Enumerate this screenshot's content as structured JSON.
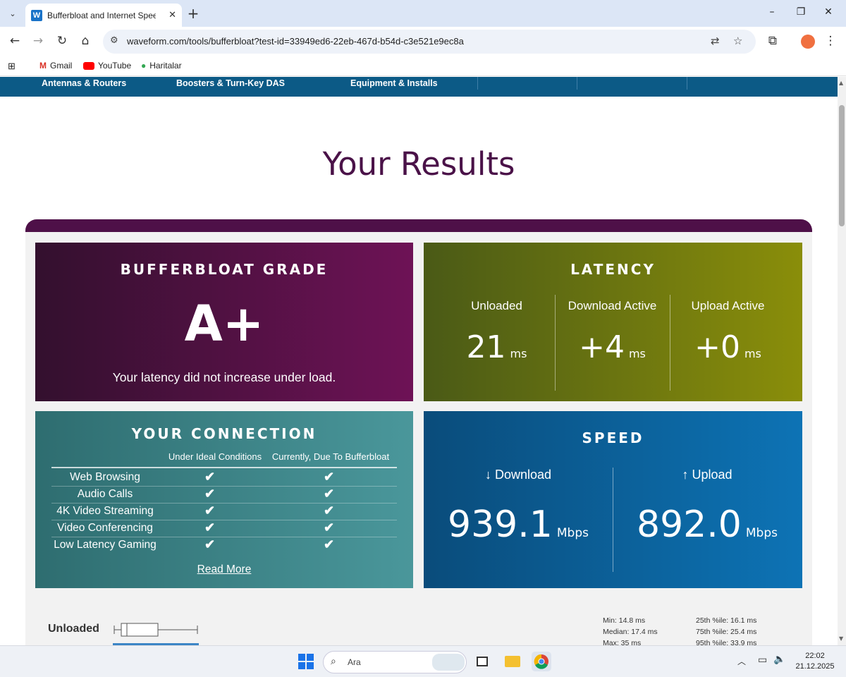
{
  "browser": {
    "tab_title": "Bufferbloat and Internet Speed",
    "tab_favicon": "W",
    "url": "waveform.com/tools/bufferbloat?test-id=33949ed6-22eb-467d-b54d-c3e521e9ec8a",
    "bookmarks": [
      "Gmail",
      "YouTube",
      "Haritalar"
    ]
  },
  "site_nav": {
    "items": [
      "Antennas & Routers",
      "Boosters & Turn-Key DAS",
      "Equipment & Installs"
    ]
  },
  "page": {
    "title": "Your Results"
  },
  "grade_card": {
    "heading": "BUFFERBLOAT GRADE",
    "grade": "A+",
    "message": "Your latency did not increase under load."
  },
  "latency_card": {
    "heading": "LATENCY",
    "columns": [
      {
        "label": "Unloaded",
        "value": "21",
        "unit": "ms"
      },
      {
        "label": "Download Active",
        "value": "+4",
        "unit": "ms"
      },
      {
        "label": "Upload Active",
        "value": "+0",
        "unit": "ms"
      }
    ]
  },
  "connection_card": {
    "heading": "YOUR CONNECTION",
    "col_ideal": "Under Ideal Conditions",
    "col_current": "Currently, Due To Bufferbloat",
    "rows": [
      {
        "name": "Web Browsing",
        "ideal": "✔",
        "current": "✔"
      },
      {
        "name": "Audio Calls",
        "ideal": "✔",
        "current": "✔"
      },
      {
        "name": "4K Video Streaming",
        "ideal": "✔",
        "current": "✔"
      },
      {
        "name": "Video Conferencing",
        "ideal": "✔",
        "current": "✔"
      },
      {
        "name": "Low Latency Gaming",
        "ideal": "✔",
        "current": "✔"
      }
    ],
    "read_more": "Read More"
  },
  "speed_card": {
    "heading": "SPEED",
    "download_label": "↓ Download",
    "download_value": "939.1",
    "download_unit": "Mbps",
    "upload_label": "↑ Upload",
    "upload_value": "892.0",
    "upload_unit": "Mbps"
  },
  "unloaded_stats": {
    "label": "Unloaded",
    "min": "Min: 14.8 ms",
    "median": "Median: 17.4 ms",
    "max": "Max: 35 ms",
    "p25": "25th %ile: 16.1 ms",
    "p75": "75th %ile: 25.4 ms",
    "p95": "95th %ile: 33.9 ms"
  },
  "taskbar": {
    "search_placeholder": "Ara",
    "time": "22:02",
    "date": "21.12.2025"
  },
  "colors": {
    "grade_card": "#6e1256",
    "latency_card": "#8a8e0a",
    "connection_card": "#4a979b",
    "speed_card": "#0d73b5",
    "title": "#4a1248",
    "site_nav": "#0c5a86"
  }
}
